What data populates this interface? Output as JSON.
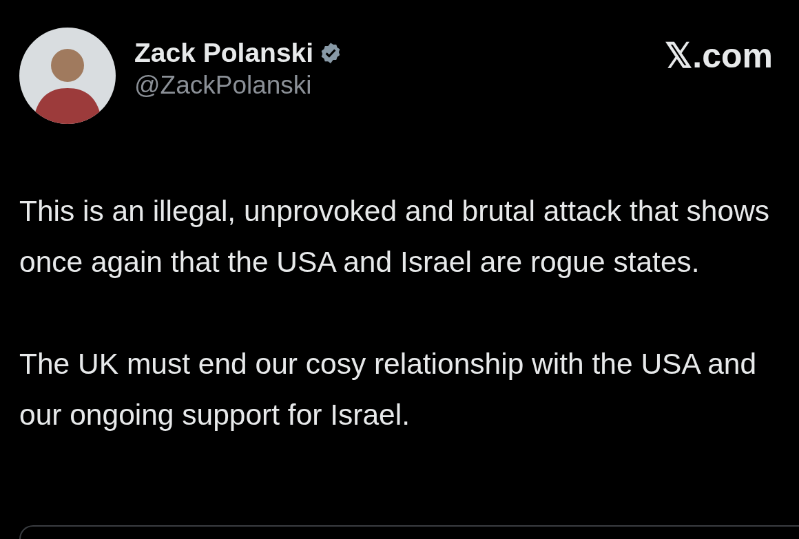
{
  "author": {
    "name": "Zack Polanski",
    "verified": true,
    "handle": "@ZackPolanski"
  },
  "source": "𝕏.com",
  "post": {
    "paragraphs": [
      "This is an illegal, unprovoked and brutal attack that shows once again that the USA and Israel are rogue states.",
      "The UK must end our cosy relationship with the USA and our ongoing support for Israel."
    ]
  }
}
